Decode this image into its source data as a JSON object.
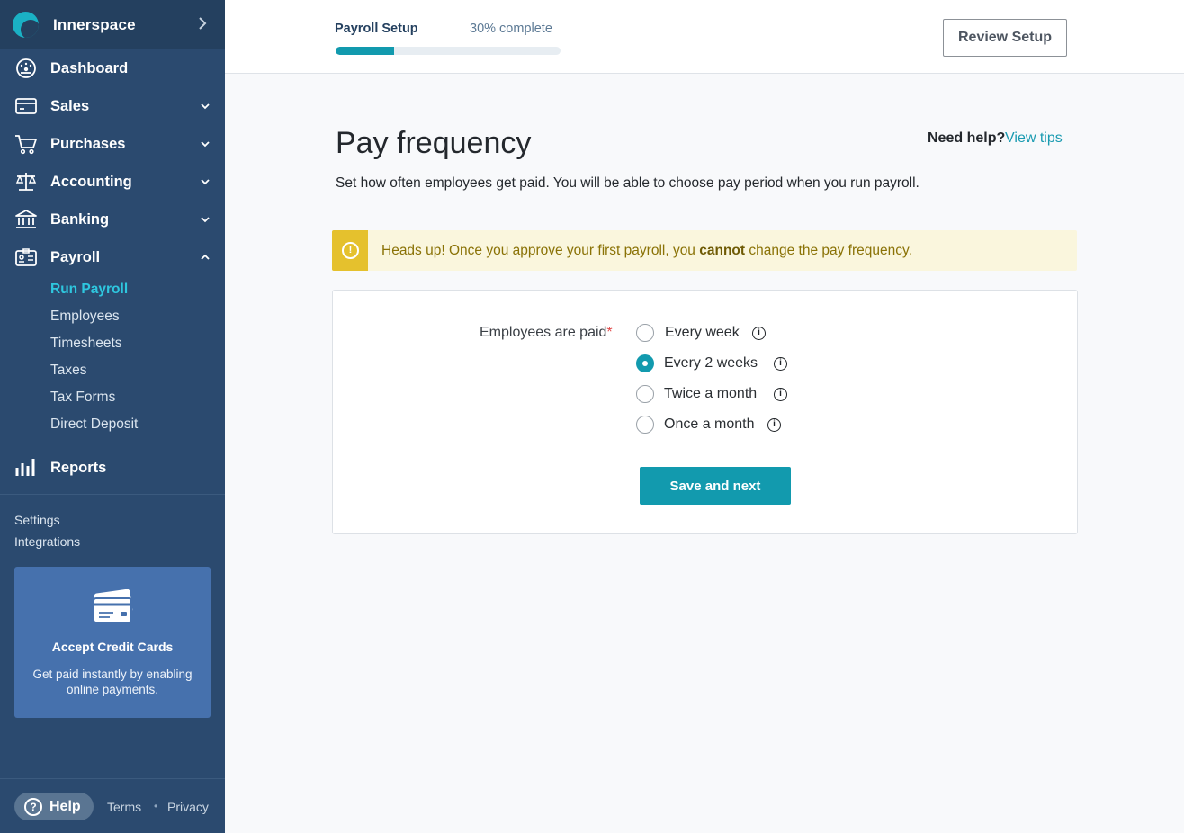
{
  "app": {
    "name": "Innerspace"
  },
  "sidebar": {
    "nav": [
      {
        "label": "Dashboard",
        "icon": "dashboard-icon"
      },
      {
        "label": "Sales",
        "icon": "card-icon"
      },
      {
        "label": "Purchases",
        "icon": "cart-icon"
      },
      {
        "label": "Accounting",
        "icon": "scale-icon"
      },
      {
        "label": "Banking",
        "icon": "bank-icon"
      },
      {
        "label": "Payroll",
        "icon": "id-card-icon"
      },
      {
        "label": "Reports",
        "icon": "bar-chart-icon"
      }
    ],
    "payroll_sub": [
      "Run Payroll",
      "Employees",
      "Timesheets",
      "Taxes",
      "Tax Forms",
      "Direct Deposit"
    ],
    "settings": "Settings",
    "integrations": "Integrations",
    "promo": {
      "title": "Accept Credit Cards",
      "text": "Get paid instantly by enabling online payments."
    },
    "help": "Help",
    "terms": "Terms",
    "dot": "•",
    "privacy": "Privacy"
  },
  "topbar": {
    "progress_title": "Payroll Setup",
    "progress_text": "30% complete",
    "progress_fraction": 0.26,
    "review_button": "Review Setup"
  },
  "main": {
    "title": "Pay frequency",
    "help_text": "Need help?",
    "help_link": "View tips",
    "subtitle": "Set how often employees get paid. You will be able to choose pay period when you run payroll.",
    "alert": {
      "before": "Heads up! Once you approve your first payroll, you ",
      "bold": "cannot",
      "after": " change the pay frequency."
    },
    "field_label": "Employees are paid",
    "required_mark": "*",
    "options": [
      {
        "label": "Every week",
        "selected": false
      },
      {
        "label": "Every 2 weeks",
        "selected": true
      },
      {
        "label": "Twice a month",
        "selected": false
      },
      {
        "label": "Once a month",
        "selected": false
      }
    ],
    "save_button": "Save and next"
  },
  "colors": {
    "sidebar": "#2b4a6f",
    "accent": "#129aae",
    "active_link": "#2ec7df",
    "warning": "#e5c12d"
  }
}
